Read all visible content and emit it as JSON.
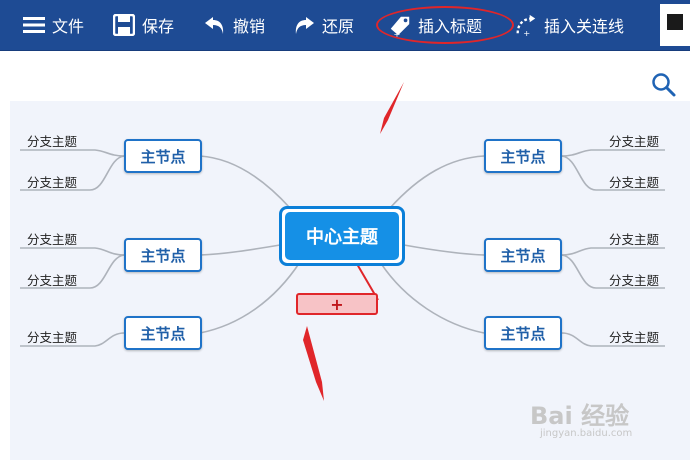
{
  "toolbar": {
    "file": "文件",
    "save": "保存",
    "undo": "撤销",
    "redo": "还原",
    "insert_title": "插入标题",
    "insert_link": "插入关连线"
  },
  "mindmap": {
    "center": "中心主题",
    "left_nodes": [
      {
        "label": "主节点",
        "leaves": [
          "分支主题",
          "分支主题"
        ]
      },
      {
        "label": "主节点",
        "leaves": [
          "分支主题",
          "分支主题"
        ]
      },
      {
        "label": "主节点",
        "leaves": [
          "分支主题"
        ]
      }
    ],
    "right_nodes": [
      {
        "label": "主节点",
        "leaves": [
          "分支主题",
          "分支主题"
        ]
      },
      {
        "label": "主节点",
        "leaves": [
          "分支主题",
          "分支主题"
        ]
      },
      {
        "label": "主节点",
        "leaves": [
          "分支主题"
        ]
      }
    ],
    "add_button": "+"
  },
  "watermark": {
    "main": "Bai 经验",
    "sub": "jingyan.baidu.com"
  },
  "colors": {
    "toolbar_bg": "#1e4b94",
    "canvas_bg": "#f1f4fb",
    "center_fill": "#1590e6",
    "node_border": "#1f73c8",
    "annotation_red": "#e0262a"
  },
  "icons": [
    "menu-icon",
    "save-icon",
    "undo-icon",
    "redo-icon",
    "tag-icon",
    "link-icon",
    "search-icon"
  ]
}
